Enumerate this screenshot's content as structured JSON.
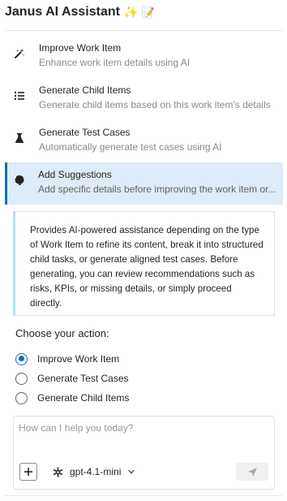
{
  "header": {
    "title": "Janus AI Assistant",
    "sparkle_emoji": "✨",
    "memo_emoji": "📝"
  },
  "menu": {
    "items": [
      {
        "icon": "magic-wand-icon",
        "title": "Improve Work Item",
        "description": "Enhance work item details using AI",
        "active": false
      },
      {
        "icon": "list-icon",
        "title": "Generate Child Items",
        "description": "Generate child items based on this work item's details",
        "active": false
      },
      {
        "icon": "flask-icon",
        "title": "Generate Test Cases",
        "description": "Automatically generate test cases using AI",
        "active": false
      },
      {
        "icon": "brain-icon",
        "title": "Add Suggestions",
        "description": "Add specific details before improving the work item or...",
        "active": true
      }
    ]
  },
  "info": {
    "text": "Provides AI-powered assistance depending on the type of Work Item to refine its content, break it into structured child tasks, or generate aligned test cases. Before generating, you can review recommendations such as risks, KPIs, or missing details, or simply proceed directly."
  },
  "actions": {
    "label": "Choose your action:",
    "options": [
      {
        "label": "Improve Work Item",
        "checked": true
      },
      {
        "label": "Generate Test Cases",
        "checked": false
      },
      {
        "label": "Generate Child Items",
        "checked": false
      }
    ]
  },
  "composer": {
    "placeholder": "How can I help you today?",
    "value": "",
    "model": "gpt-4.1-mini"
  },
  "colors": {
    "accent": "#0f6cbd",
    "active_bg": "#deecf9",
    "info_border": "#a8e3f3"
  }
}
